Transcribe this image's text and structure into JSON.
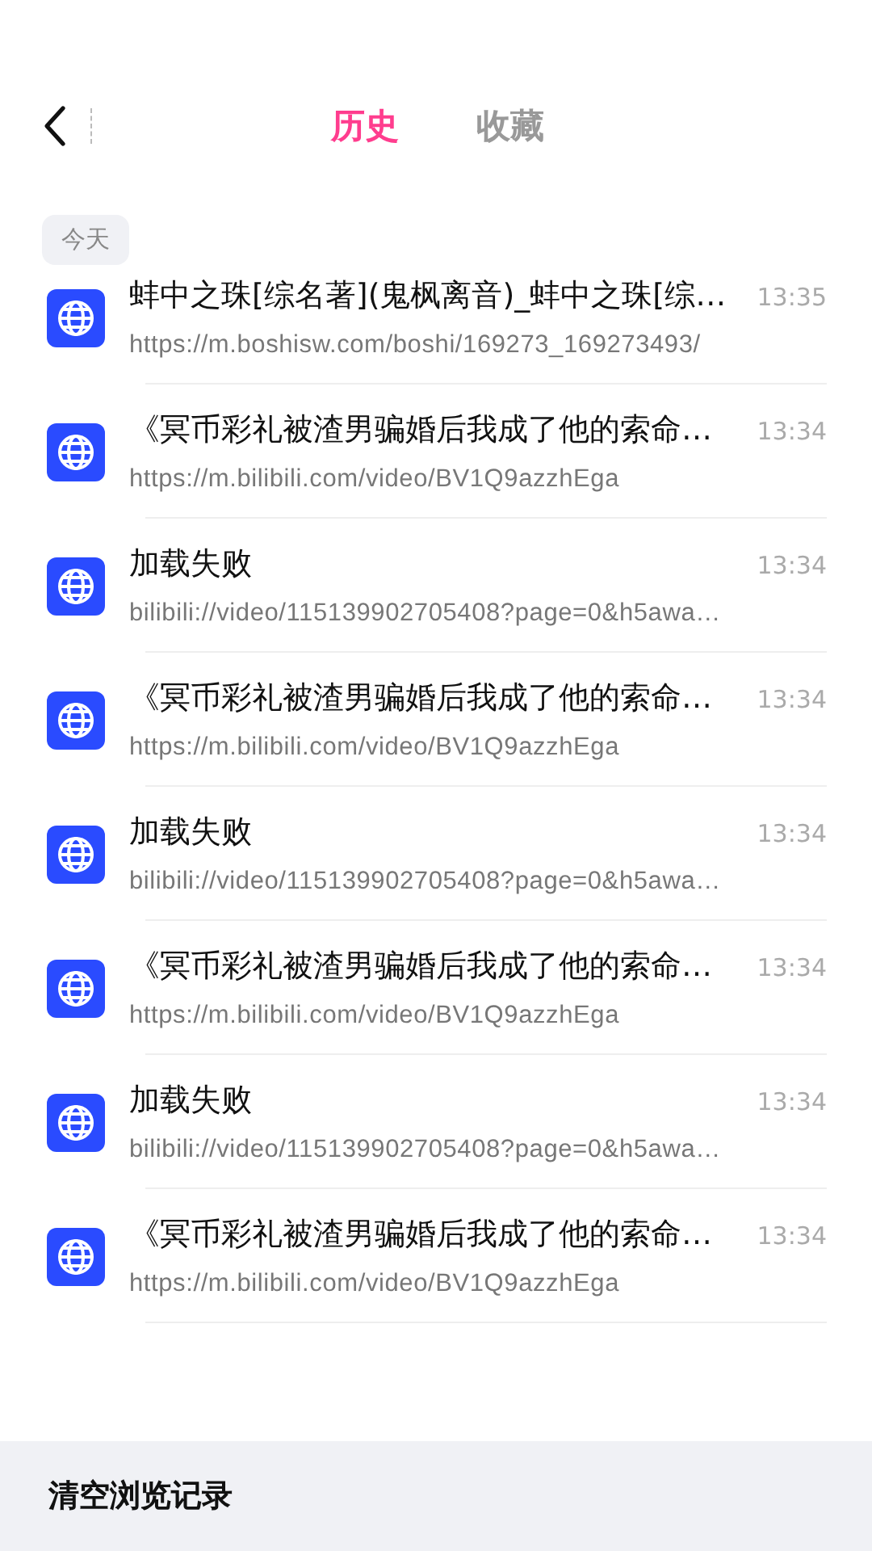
{
  "tabs": [
    {
      "label": "历史",
      "selected": true
    },
    {
      "label": "收藏",
      "selected": false
    }
  ],
  "date_label": "今天",
  "history": [
    {
      "title": "蚌中之珠[综名著](鬼枫离音)_蚌中之珠[综…",
      "url": "https://m.boshisw.com/boshi/169273_169273493/",
      "time": "13:35"
    },
    {
      "title": "《冥币彩礼被渣男骗婚后我成了他的索命…",
      "url": "https://m.bilibili.com/video/BV1Q9azzhEga",
      "time": "13:34"
    },
    {
      "title": "加载失败",
      "url": "bilibili://video/115139902705408?page=0&h5awa…",
      "time": "13:34"
    },
    {
      "title": "《冥币彩礼被渣男骗婚后我成了他的索命…",
      "url": "https://m.bilibili.com/video/BV1Q9azzhEga",
      "time": "13:34"
    },
    {
      "title": "加载失败",
      "url": "bilibili://video/115139902705408?page=0&h5awa…",
      "time": "13:34"
    },
    {
      "title": "《冥币彩礼被渣男骗婚后我成了他的索命…",
      "url": "https://m.bilibili.com/video/BV1Q9azzhEga",
      "time": "13:34"
    },
    {
      "title": "加载失败",
      "url": "bilibili://video/115139902705408?page=0&h5awa…",
      "time": "13:34"
    },
    {
      "title": "《冥币彩礼被渣男骗婚后我成了他的索命…",
      "url": "https://m.bilibili.com/video/BV1Q9azzhEga",
      "time": "13:34"
    }
  ],
  "clear_button": "清空浏览记录"
}
